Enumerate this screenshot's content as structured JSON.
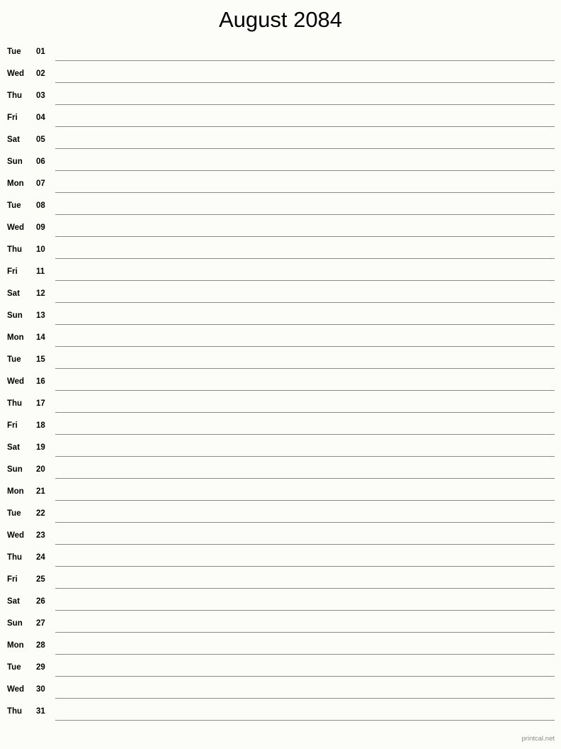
{
  "document": {
    "title": "August 2084",
    "month": "August",
    "year": "2084",
    "footer_text": "printcal.net",
    "colors": {
      "background": "#fcfdf9",
      "text": "#000000",
      "rule": "#8a8a8a",
      "footer_text": "#8a8a8a"
    }
  },
  "days": [
    {
      "weekday": "Tue",
      "number": "01"
    },
    {
      "weekday": "Wed",
      "number": "02"
    },
    {
      "weekday": "Thu",
      "number": "03"
    },
    {
      "weekday": "Fri",
      "number": "04"
    },
    {
      "weekday": "Sat",
      "number": "05"
    },
    {
      "weekday": "Sun",
      "number": "06"
    },
    {
      "weekday": "Mon",
      "number": "07"
    },
    {
      "weekday": "Tue",
      "number": "08"
    },
    {
      "weekday": "Wed",
      "number": "09"
    },
    {
      "weekday": "Thu",
      "number": "10"
    },
    {
      "weekday": "Fri",
      "number": "11"
    },
    {
      "weekday": "Sat",
      "number": "12"
    },
    {
      "weekday": "Sun",
      "number": "13"
    },
    {
      "weekday": "Mon",
      "number": "14"
    },
    {
      "weekday": "Tue",
      "number": "15"
    },
    {
      "weekday": "Wed",
      "number": "16"
    },
    {
      "weekday": "Thu",
      "number": "17"
    },
    {
      "weekday": "Fri",
      "number": "18"
    },
    {
      "weekday": "Sat",
      "number": "19"
    },
    {
      "weekday": "Sun",
      "number": "20"
    },
    {
      "weekday": "Mon",
      "number": "21"
    },
    {
      "weekday": "Tue",
      "number": "22"
    },
    {
      "weekday": "Wed",
      "number": "23"
    },
    {
      "weekday": "Thu",
      "number": "24"
    },
    {
      "weekday": "Fri",
      "number": "25"
    },
    {
      "weekday": "Sat",
      "number": "26"
    },
    {
      "weekday": "Sun",
      "number": "27"
    },
    {
      "weekday": "Mon",
      "number": "28"
    },
    {
      "weekday": "Tue",
      "number": "29"
    },
    {
      "weekday": "Wed",
      "number": "30"
    },
    {
      "weekday": "Thu",
      "number": "31"
    }
  ]
}
